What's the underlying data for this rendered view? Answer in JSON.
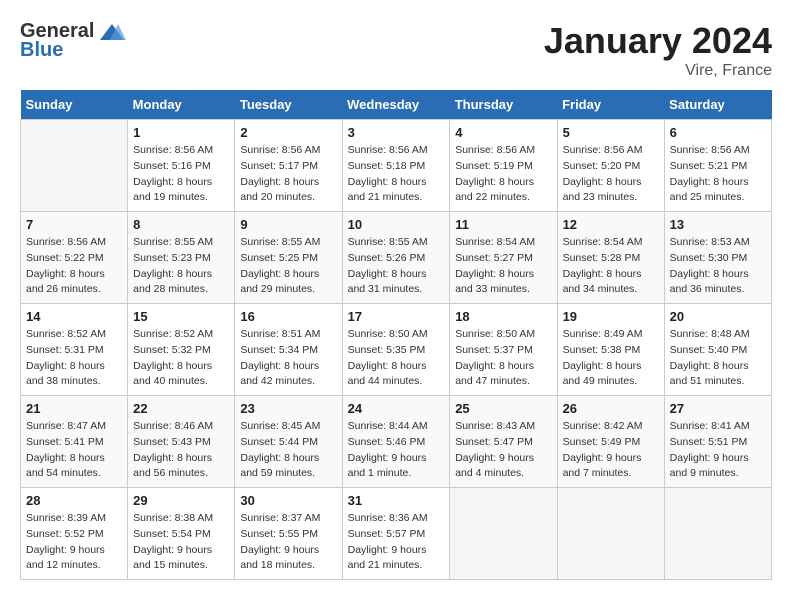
{
  "header": {
    "logo_general": "General",
    "logo_blue": "Blue",
    "title": "January 2024",
    "location": "Vire, France"
  },
  "weekdays": [
    "Sunday",
    "Monday",
    "Tuesday",
    "Wednesday",
    "Thursday",
    "Friday",
    "Saturday"
  ],
  "weeks": [
    [
      {
        "day": "",
        "sunrise": "",
        "sunset": "",
        "daylight": ""
      },
      {
        "day": "1",
        "sunrise": "Sunrise: 8:56 AM",
        "sunset": "Sunset: 5:16 PM",
        "daylight": "Daylight: 8 hours and 19 minutes."
      },
      {
        "day": "2",
        "sunrise": "Sunrise: 8:56 AM",
        "sunset": "Sunset: 5:17 PM",
        "daylight": "Daylight: 8 hours and 20 minutes."
      },
      {
        "day": "3",
        "sunrise": "Sunrise: 8:56 AM",
        "sunset": "Sunset: 5:18 PM",
        "daylight": "Daylight: 8 hours and 21 minutes."
      },
      {
        "day": "4",
        "sunrise": "Sunrise: 8:56 AM",
        "sunset": "Sunset: 5:19 PM",
        "daylight": "Daylight: 8 hours and 22 minutes."
      },
      {
        "day": "5",
        "sunrise": "Sunrise: 8:56 AM",
        "sunset": "Sunset: 5:20 PM",
        "daylight": "Daylight: 8 hours and 23 minutes."
      },
      {
        "day": "6",
        "sunrise": "Sunrise: 8:56 AM",
        "sunset": "Sunset: 5:21 PM",
        "daylight": "Daylight: 8 hours and 25 minutes."
      }
    ],
    [
      {
        "day": "7",
        "sunrise": "Sunrise: 8:56 AM",
        "sunset": "Sunset: 5:22 PM",
        "daylight": "Daylight: 8 hours and 26 minutes."
      },
      {
        "day": "8",
        "sunrise": "Sunrise: 8:55 AM",
        "sunset": "Sunset: 5:23 PM",
        "daylight": "Daylight: 8 hours and 28 minutes."
      },
      {
        "day": "9",
        "sunrise": "Sunrise: 8:55 AM",
        "sunset": "Sunset: 5:25 PM",
        "daylight": "Daylight: 8 hours and 29 minutes."
      },
      {
        "day": "10",
        "sunrise": "Sunrise: 8:55 AM",
        "sunset": "Sunset: 5:26 PM",
        "daylight": "Daylight: 8 hours and 31 minutes."
      },
      {
        "day": "11",
        "sunrise": "Sunrise: 8:54 AM",
        "sunset": "Sunset: 5:27 PM",
        "daylight": "Daylight: 8 hours and 33 minutes."
      },
      {
        "day": "12",
        "sunrise": "Sunrise: 8:54 AM",
        "sunset": "Sunset: 5:28 PM",
        "daylight": "Daylight: 8 hours and 34 minutes."
      },
      {
        "day": "13",
        "sunrise": "Sunrise: 8:53 AM",
        "sunset": "Sunset: 5:30 PM",
        "daylight": "Daylight: 8 hours and 36 minutes."
      }
    ],
    [
      {
        "day": "14",
        "sunrise": "Sunrise: 8:52 AM",
        "sunset": "Sunset: 5:31 PM",
        "daylight": "Daylight: 8 hours and 38 minutes."
      },
      {
        "day": "15",
        "sunrise": "Sunrise: 8:52 AM",
        "sunset": "Sunset: 5:32 PM",
        "daylight": "Daylight: 8 hours and 40 minutes."
      },
      {
        "day": "16",
        "sunrise": "Sunrise: 8:51 AM",
        "sunset": "Sunset: 5:34 PM",
        "daylight": "Daylight: 8 hours and 42 minutes."
      },
      {
        "day": "17",
        "sunrise": "Sunrise: 8:50 AM",
        "sunset": "Sunset: 5:35 PM",
        "daylight": "Daylight: 8 hours and 44 minutes."
      },
      {
        "day": "18",
        "sunrise": "Sunrise: 8:50 AM",
        "sunset": "Sunset: 5:37 PM",
        "daylight": "Daylight: 8 hours and 47 minutes."
      },
      {
        "day": "19",
        "sunrise": "Sunrise: 8:49 AM",
        "sunset": "Sunset: 5:38 PM",
        "daylight": "Daylight: 8 hours and 49 minutes."
      },
      {
        "day": "20",
        "sunrise": "Sunrise: 8:48 AM",
        "sunset": "Sunset: 5:40 PM",
        "daylight": "Daylight: 8 hours and 51 minutes."
      }
    ],
    [
      {
        "day": "21",
        "sunrise": "Sunrise: 8:47 AM",
        "sunset": "Sunset: 5:41 PM",
        "daylight": "Daylight: 8 hours and 54 minutes."
      },
      {
        "day": "22",
        "sunrise": "Sunrise: 8:46 AM",
        "sunset": "Sunset: 5:43 PM",
        "daylight": "Daylight: 8 hours and 56 minutes."
      },
      {
        "day": "23",
        "sunrise": "Sunrise: 8:45 AM",
        "sunset": "Sunset: 5:44 PM",
        "daylight": "Daylight: 8 hours and 59 minutes."
      },
      {
        "day": "24",
        "sunrise": "Sunrise: 8:44 AM",
        "sunset": "Sunset: 5:46 PM",
        "daylight": "Daylight: 9 hours and 1 minute."
      },
      {
        "day": "25",
        "sunrise": "Sunrise: 8:43 AM",
        "sunset": "Sunset: 5:47 PM",
        "daylight": "Daylight: 9 hours and 4 minutes."
      },
      {
        "day": "26",
        "sunrise": "Sunrise: 8:42 AM",
        "sunset": "Sunset: 5:49 PM",
        "daylight": "Daylight: 9 hours and 7 minutes."
      },
      {
        "day": "27",
        "sunrise": "Sunrise: 8:41 AM",
        "sunset": "Sunset: 5:51 PM",
        "daylight": "Daylight: 9 hours and 9 minutes."
      }
    ],
    [
      {
        "day": "28",
        "sunrise": "Sunrise: 8:39 AM",
        "sunset": "Sunset: 5:52 PM",
        "daylight": "Daylight: 9 hours and 12 minutes."
      },
      {
        "day": "29",
        "sunrise": "Sunrise: 8:38 AM",
        "sunset": "Sunset: 5:54 PM",
        "daylight": "Daylight: 9 hours and 15 minutes."
      },
      {
        "day": "30",
        "sunrise": "Sunrise: 8:37 AM",
        "sunset": "Sunset: 5:55 PM",
        "daylight": "Daylight: 9 hours and 18 minutes."
      },
      {
        "day": "31",
        "sunrise": "Sunrise: 8:36 AM",
        "sunset": "Sunset: 5:57 PM",
        "daylight": "Daylight: 9 hours and 21 minutes."
      },
      {
        "day": "",
        "sunrise": "",
        "sunset": "",
        "daylight": ""
      },
      {
        "day": "",
        "sunrise": "",
        "sunset": "",
        "daylight": ""
      },
      {
        "day": "",
        "sunrise": "",
        "sunset": "",
        "daylight": ""
      }
    ]
  ]
}
